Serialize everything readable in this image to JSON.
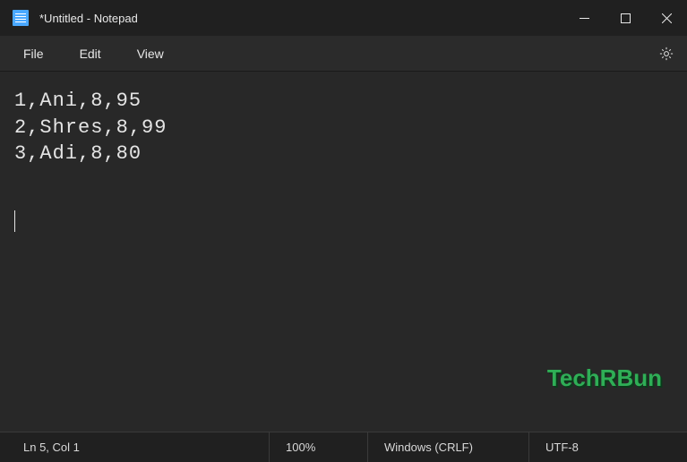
{
  "titlebar": {
    "title": "*Untitled - Notepad"
  },
  "menubar": {
    "items": [
      {
        "label": "File"
      },
      {
        "label": "Edit"
      },
      {
        "label": "View"
      }
    ]
  },
  "editor": {
    "lines": [
      "1,Ani,8,95",
      "2,Shres,8,99",
      "3,Adi,8,80"
    ]
  },
  "watermark": {
    "text": "TechRBun"
  },
  "statusbar": {
    "position": "Ln 5, Col 1",
    "zoom": "100%",
    "eol": "Windows (CRLF)",
    "encoding": "UTF-8"
  }
}
